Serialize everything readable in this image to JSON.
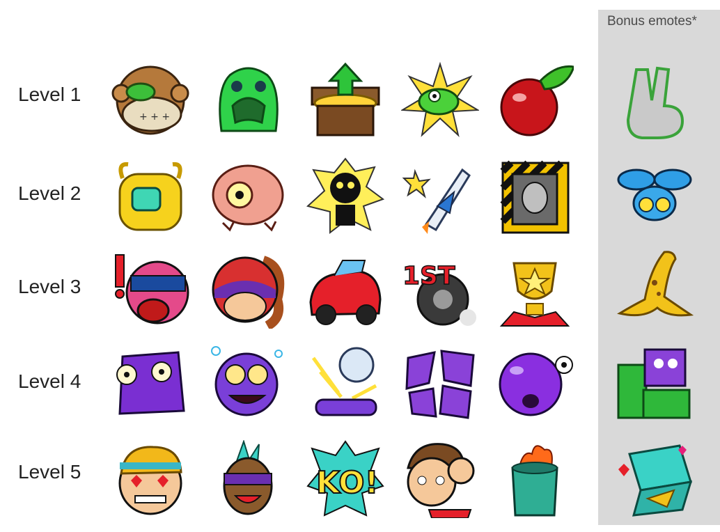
{
  "bonus_panel": {
    "title": "Bonus emotes*"
  },
  "levels": [
    {
      "label": "Level 1",
      "emotes": [
        "monkey-face-icon",
        "green-slime-icon",
        "treasure-chest-icon",
        "frog-explosion-icon",
        "cherry-icon"
      ],
      "bonus": "peace-hand-icon"
    },
    {
      "label": "Level 2",
      "emotes": [
        "yellow-alien-blob-icon",
        "brain-monster-icon",
        "electrocuted-skeleton-icon",
        "rocket-ship-icon",
        "alien-warning-sign-icon"
      ],
      "bonus": "blue-fly-robot-icon"
    },
    {
      "label": "Level 3",
      "emotes": [
        "screaming-helmet-icon",
        "helmet-girl-icon",
        "red-car-icon",
        "first-place-tire-icon",
        "gold-trophy-icon"
      ],
      "bonus": "banana-peel-icon"
    },
    {
      "label": "Level 4",
      "emotes": [
        "purple-cube-face-icon",
        "dizzy-purple-monster-icon",
        "crystal-ball-pedestal-icon",
        "broken-crystal-icon",
        "purple-blob-icon"
      ],
      "bonus": "green-blocks-icon"
    },
    {
      "label": "Level 5",
      "emotes": [
        "heart-eyes-girl-icon",
        "punk-sunglasses-icon",
        "ko-burst-icon",
        "fist-boy-icon",
        "burning-trash-can-icon"
      ],
      "bonus": "pizza-box-icon"
    }
  ],
  "colors": {
    "panel_bg": "#d9d9d9",
    "label_text": "#222222",
    "panel_title_text": "#4a4a4a"
  }
}
